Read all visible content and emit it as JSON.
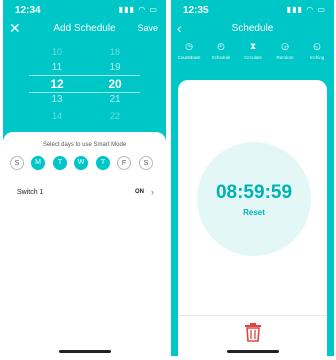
{
  "left": {
    "status_time": "12:34",
    "status_icons": "▮▮▮ ◠ ▭",
    "title": "Add Schedule",
    "close_icon": "close-icon",
    "save_label": "Save",
    "hours": [
      "10",
      "11",
      "12",
      "13",
      "14"
    ],
    "minutes": [
      "18",
      "19",
      "20",
      "21",
      "22"
    ],
    "caption": "Select days to use Smart Mode",
    "days": [
      {
        "label": "S",
        "selected": false
      },
      {
        "label": "M",
        "selected": true
      },
      {
        "label": "T",
        "selected": true
      },
      {
        "label": "W",
        "selected": true
      },
      {
        "label": "T",
        "selected": true
      },
      {
        "label": "F",
        "selected": false
      },
      {
        "label": "S",
        "selected": false
      }
    ],
    "switch_label": "Switch 1",
    "switch_value": "ON"
  },
  "right": {
    "status_time": "12:35",
    "status_icons": "▮▮▮ ◠ ▭",
    "title": "Schedule",
    "tabs": [
      {
        "label": "Countdown",
        "icon": "clock-icon",
        "active": true
      },
      {
        "label": "Schedule",
        "icon": "calendar-clock-icon",
        "active": false
      },
      {
        "label": "Circulate",
        "icon": "hourglass-icon",
        "active": false
      },
      {
        "label": "Random",
        "icon": "timer-icon",
        "active": false
      },
      {
        "label": "Inching",
        "icon": "stopwatch-icon",
        "active": false
      }
    ],
    "timer": "08:59:59",
    "reset_label": "Reset"
  },
  "colors": {
    "accent": "#00c7c7",
    "accent_text": "#00b3b3",
    "danger": "#e04646"
  }
}
